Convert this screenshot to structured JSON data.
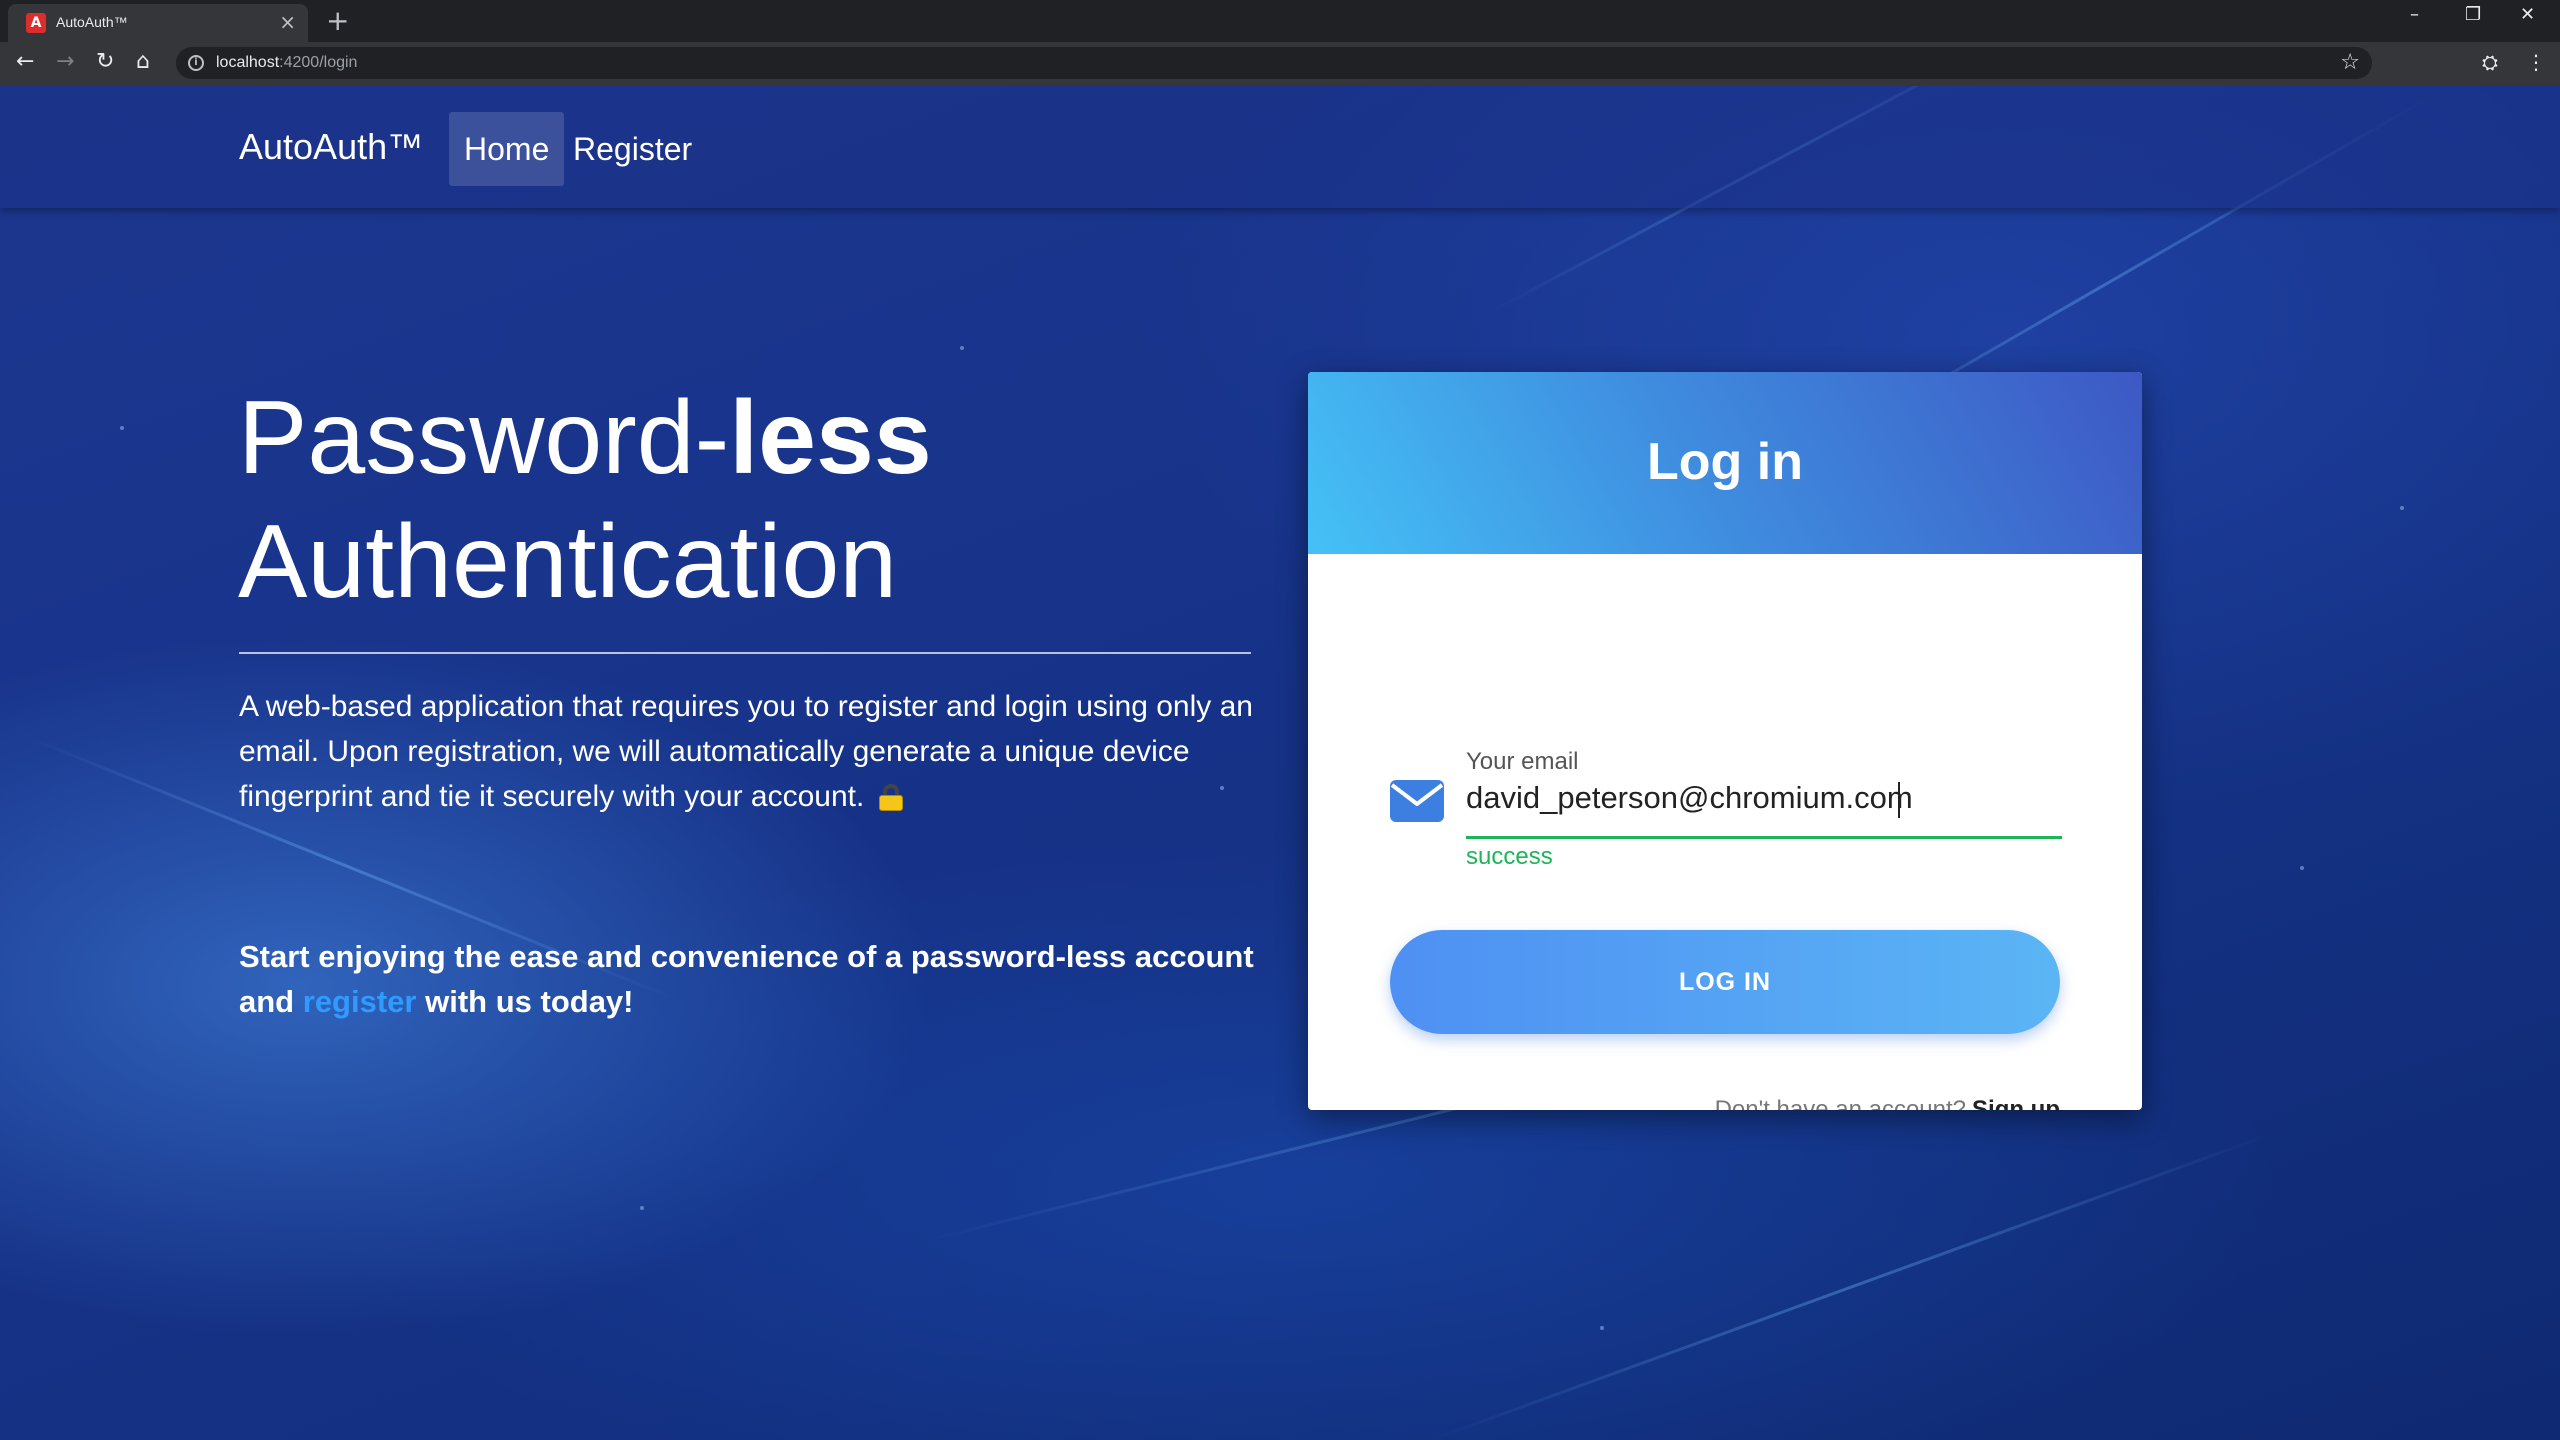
{
  "browser": {
    "tab_title": "AutoAuth™",
    "tab_favicon": "A",
    "url_host": "localhost",
    "url_path": ":4200/login"
  },
  "icons": {
    "back": "back-arrow-icon",
    "forward": "forward-arrow-icon",
    "reload": "reload-icon",
    "home": "home-icon",
    "info": "info-icon",
    "bookmark": "star-icon",
    "incognito": "incognito-icon",
    "menu": "more-vert-icon",
    "email": "envelope-icon",
    "lock": "lock-icon"
  },
  "navbar": {
    "brand": "AutoAuth™",
    "links": [
      {
        "label": "Home",
        "active": true
      },
      {
        "label": "Register",
        "active": false
      }
    ]
  },
  "hero": {
    "title_light": "Password-",
    "title_bold": "less",
    "title_line2": "Authentication",
    "description": "A web-based application that requires you to register and login using only an email. Upon registration, we will automatically generate a unique device fingerprint and tie it securely with your account.",
    "cta_before": "Start enjoying the ease and convenience of a password-less account and",
    "cta_link": "register",
    "cta_after": "with us today!"
  },
  "login": {
    "title": "Log in",
    "email_label": "Your email",
    "email_value": "david_peterson@chromium.com",
    "email_status": "success",
    "button_label": "LOG IN",
    "signup_prompt": "Don't have an account?",
    "signup_link": "Sign up"
  },
  "colors": {
    "accent": "#2f9bff",
    "success": "#1fb35a",
    "button_start": "#4e90f3",
    "button_end": "#5bb5f4",
    "header_start": "#45c1f6",
    "header_end": "#3d58c4"
  }
}
